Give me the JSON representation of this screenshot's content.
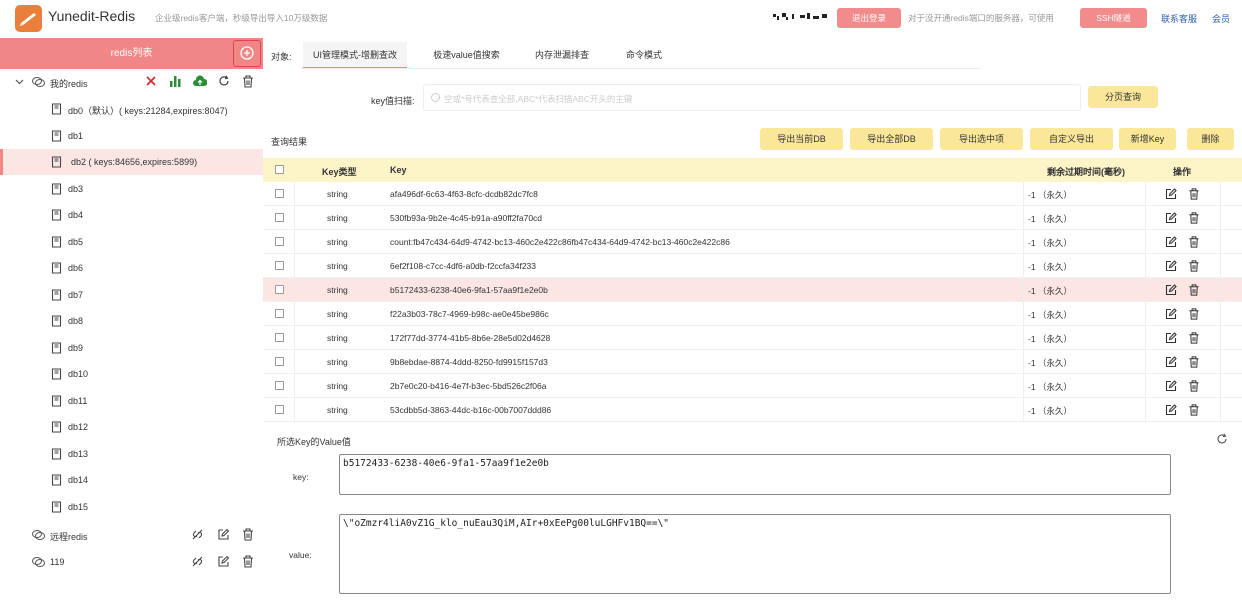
{
  "app": {
    "title": "Yunedit-Redis",
    "tagline": "企业级redis客户端，秒级导出导入10万级数据",
    "logout_label": "退出登录",
    "ssh_note": "对于没开通redis端口的服务器，可使用",
    "ssh_label": "SSH隧道",
    "support_label": "联系客服",
    "member_label": "会员"
  },
  "sidebar": {
    "title": "redis列表",
    "connections": [
      {
        "name": "我的redis",
        "expanded": true
      },
      {
        "name": "远程redis",
        "expanded": false
      },
      {
        "name": "119",
        "expanded": false
      }
    ],
    "dbs": [
      {
        "label": "db0（默认）( keys:21284,expires:8047)"
      },
      {
        "label": "db1"
      },
      {
        "label": "db2 ( keys:84656,expires:5899)",
        "selected": true
      },
      {
        "label": "db3"
      },
      {
        "label": "db4"
      },
      {
        "label": "db5"
      },
      {
        "label": "db6"
      },
      {
        "label": "db7"
      },
      {
        "label": "db8"
      },
      {
        "label": "db9"
      },
      {
        "label": "db10"
      },
      {
        "label": "db11"
      },
      {
        "label": "db12"
      },
      {
        "label": "db13"
      },
      {
        "label": "db14"
      },
      {
        "label": "db15"
      }
    ]
  },
  "main": {
    "object_label": "对象:",
    "tabs": [
      "UI管理模式-增删查改",
      "极速value值搜索",
      "内存泄漏排查",
      "命令模式"
    ],
    "active_tab": 0,
    "scan_label": "key值扫描:",
    "scan_placeholder": "空或*号代表查全部,ABC*代表扫描ABC开头的主键",
    "page_query_label": "分页查询",
    "result_label": "查询结果",
    "actions": [
      "导出当前DB",
      "导出全部DB",
      "导出选中项",
      "自定义导出",
      "新增Key",
      "删除"
    ],
    "columns": {
      "type": "Key类型",
      "key": "Key",
      "ttl": "剩余过期时间(毫秒)",
      "ops": "操作"
    },
    "rows": [
      {
        "type": "string",
        "key": "afa496df-6c63-4f63-8cfc-dcdb82dc7fc8",
        "ttl": "-1 （永久）"
      },
      {
        "type": "string",
        "key": "530fb93a-9b2e-4c45-b91a-a90ff2fa70cd",
        "ttl": "-1 （永久）"
      },
      {
        "type": "string",
        "key": "count:fb47c434-64d9-4742-bc13-460c2e422c86fb47c434-64d9-4742-bc13-460c2e422c86",
        "ttl": "-1 （永久）"
      },
      {
        "type": "string",
        "key": "6ef2f108-c7cc-4df6-a0db-f2ccfa34f233",
        "ttl": "-1 （永久）"
      },
      {
        "type": "string",
        "key": "b5172433-6238-40e6-9fa1-57aa9f1e2e0b",
        "ttl": "-1 （永久）",
        "selected": true
      },
      {
        "type": "string",
        "key": "f22a3b03-78c7-4969-b98c-ae0e45be986c",
        "ttl": "-1 （永久）"
      },
      {
        "type": "string",
        "key": "172f77dd-3774-41b5-8b6e-28e5d02d4628",
        "ttl": "-1 （永久）"
      },
      {
        "type": "string",
        "key": "9b8ebdae-8874-4ddd-8250-fd9915f157d3",
        "ttl": "-1 （永久）"
      },
      {
        "type": "string",
        "key": "2b7e0c20-b416-4e7f-b3ec-5bd526c2f06a",
        "ttl": "-1 （永久）"
      },
      {
        "type": "string",
        "key": "53cdbb5d-3863-44dc-b16c-00b7007ddd86",
        "ttl": "-1 （永久）"
      }
    ],
    "value_panel": {
      "title": "所选Key的Value值",
      "key_label": "key:",
      "key_value": "b5172433-6238-40e6-9fa1-57aa9f1e2e0b",
      "value_label": "value:",
      "value_value": "\\\"oZmzr4liA0vZ1G_klo_nuEau3QiM,AIr+0xEePg00luLGHFv1BQ==\\\""
    }
  },
  "colors": {
    "accent": "#f08686",
    "yellow": "#fbe79a",
    "link": "#2a5db0"
  }
}
